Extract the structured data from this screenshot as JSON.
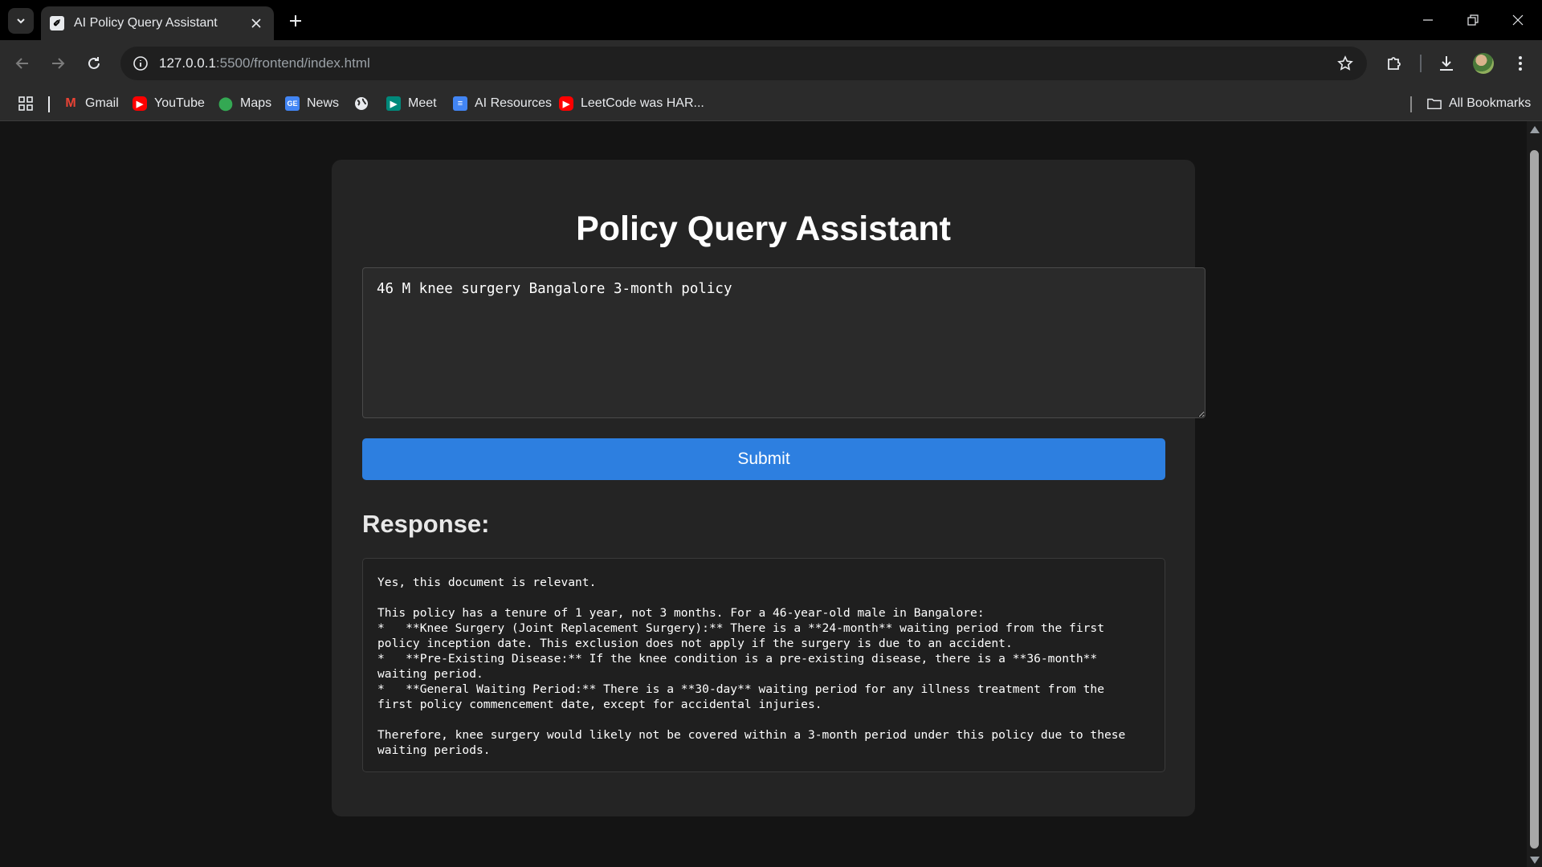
{
  "browser": {
    "tab_title": "AI Policy Query Assistant",
    "url_host": "127.0.0.1",
    "url_path": ":5500/frontend/index.html",
    "bookmarks": [
      {
        "label": "Gmail",
        "icon": "gmail-icon",
        "color": "#ea4335"
      },
      {
        "label": "YouTube",
        "icon": "youtube-icon",
        "color": "#ff0000"
      },
      {
        "label": "Maps",
        "icon": "maps-icon",
        "color": "#34a853"
      },
      {
        "label": "News",
        "icon": "news-icon",
        "color": "#4285f4"
      },
      {
        "label": "Meet",
        "icon": "meet-icon",
        "color": "#00897b"
      },
      {
        "label": "AI Resources",
        "icon": "document-icon",
        "color": "#4285f4"
      },
      {
        "label": "LeetCode was HAR...",
        "icon": "youtube-icon",
        "color": "#ff0000"
      }
    ],
    "all_bookmarks_label": "All Bookmarks"
  },
  "page": {
    "title": "Policy Query Assistant",
    "query_value": "46 M knee surgery Bangalore 3-month policy",
    "submit_label": "Submit",
    "response_heading": "Response:",
    "response_text": "Yes, this document is relevant.\n\nThis policy has a tenure of 1 year, not 3 months. For a 46-year-old male in Bangalore:\n*   **Knee Surgery (Joint Replacement Surgery):** There is a **24-month** waiting period from the first\npolicy inception date. This exclusion does not apply if the surgery is due to an accident.\n*   **Pre-Existing Disease:** If the knee condition is a pre-existing disease, there is a **36-month**\nwaiting period.\n*   **General Waiting Period:** There is a **30-day** waiting period for any illness treatment from the\nfirst policy commencement date, except for accidental injuries.\n\nTherefore, knee surgery would likely not be covered within a 3-month period under this policy due to these\nwaiting periods."
  },
  "colors": {
    "accent": "#2d7fe0",
    "card_bg": "#242424",
    "page_bg": "#141414"
  }
}
